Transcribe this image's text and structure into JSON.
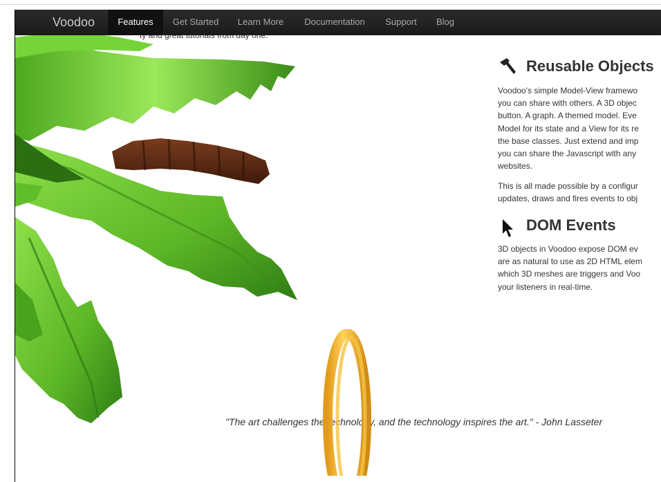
{
  "navbar": {
    "brand": "Voodoo",
    "items": [
      {
        "label": "Features",
        "active": true
      },
      {
        "label": "Get Started",
        "active": false
      },
      {
        "label": "Learn More",
        "active": false
      },
      {
        "label": "Documentation",
        "active": false
      },
      {
        "label": "Support",
        "active": false
      },
      {
        "label": "Blog",
        "active": false
      }
    ]
  },
  "cut_off_text": "ty and great tutorials from day one.",
  "sections": [
    {
      "icon": "hammer-icon",
      "title": "Reusable Objects",
      "paragraphs": [
        [
          "Voodoo's simple Model-View framewo",
          "you can share with others. A 3D objec",
          "button. A graph. A themed model. Eve",
          "Model for its state and a View for its re",
          "the base classes. Just extend and imp",
          "you can share the Javascript with any",
          "websites."
        ],
        [
          "This is all made possible by a configur",
          "updates, draws and fires events to obj"
        ]
      ]
    },
    {
      "icon": "cursor-arrow-icon",
      "title": "DOM Events",
      "paragraphs": [
        [
          "3D objects in Voodoo expose DOM ev",
          "are as natural to use as 2D HTML elem",
          "which 3D meshes are triggers and Voo",
          "your listeners in real-time."
        ]
      ]
    }
  ],
  "quote": "\"The art challenges the technology, and the technology inspires the art.\" - John Lasseter",
  "colors": {
    "navbar": "#1b1b1b",
    "navbar_active": "#111111",
    "leaf_green": "#6cc829",
    "leaf_dark": "#3f8f1a",
    "trunk": "#5a2a14",
    "ring": "#f0b431",
    "text": "#333333"
  }
}
